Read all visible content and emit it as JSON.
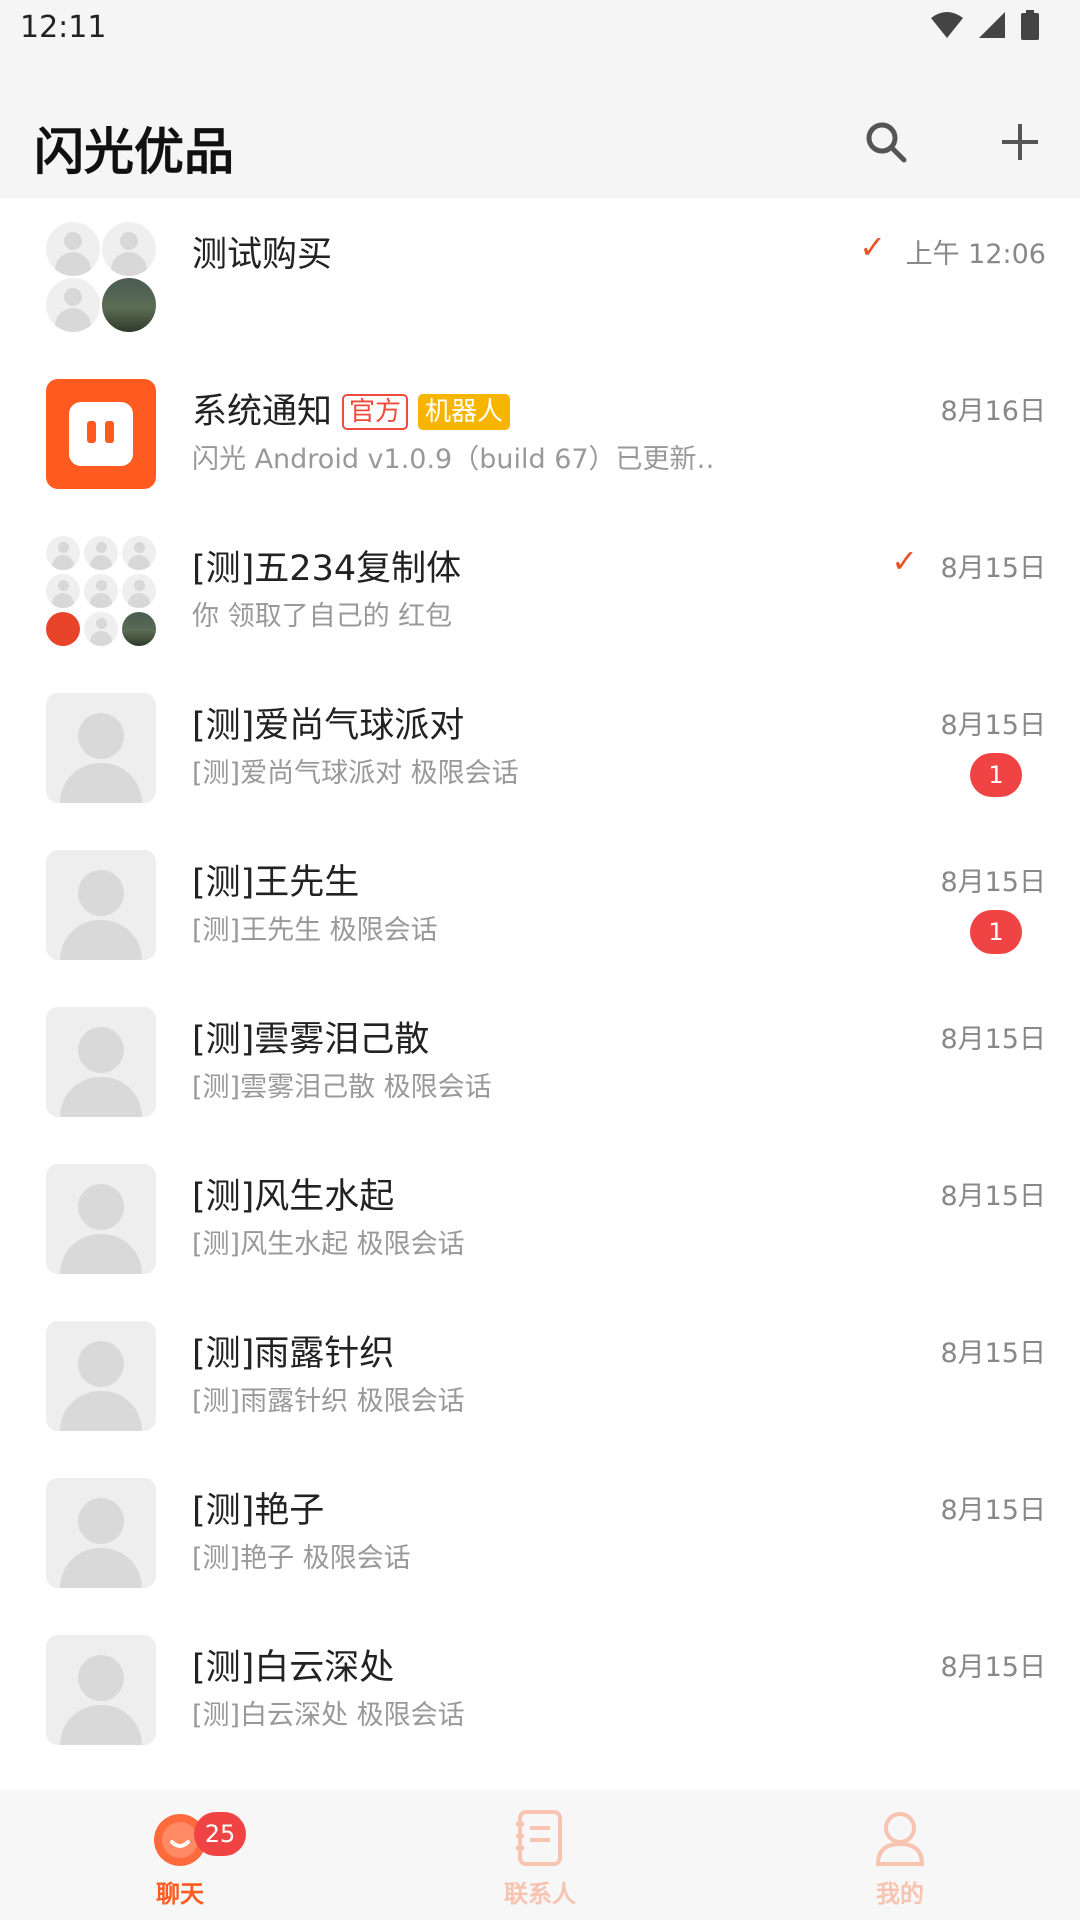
{
  "status_bar": {
    "time": "12:11"
  },
  "app_bar": {
    "title": "闪光优品",
    "search_icon": "search-icon",
    "add_icon": "plus-icon"
  },
  "colors": {
    "accent": "#ff5a1f",
    "badge": "#f04444",
    "check": "#e8552a",
    "official_tag": "#f04a3e",
    "bot_tag": "#f7b500"
  },
  "conversations": [
    {
      "name": "测试购买",
      "preview": "",
      "time": "上午 12:06",
      "sent": true,
      "avatar": "group-4"
    },
    {
      "name": "系统通知",
      "tags": [
        "官方",
        "机器人"
      ],
      "preview": "闪光 Android v1.0.9（build 67）已更新…",
      "time": "8月16日",
      "avatar": "system"
    },
    {
      "name": "[测]五234复制体",
      "preview": "你 领取了自己的 红包",
      "time": "8月15日",
      "sent": true,
      "avatar": "group-9"
    },
    {
      "name": "[测]爱尚气球派对",
      "preview": "[测]爱尚气球派对 极限会话",
      "time": "8月15日",
      "unread": "1",
      "avatar": "default"
    },
    {
      "name": "[测]王先生",
      "preview": "[测]王先生 极限会话",
      "time": "8月15日",
      "unread": "1",
      "avatar": "default"
    },
    {
      "name": "[测]雲雾泪己散",
      "preview": "[测]雲雾泪己散 极限会话",
      "time": "8月15日",
      "avatar": "default"
    },
    {
      "name": "[测]风生水起",
      "preview": "[测]风生水起 极限会话",
      "time": "8月15日",
      "avatar": "default"
    },
    {
      "name": "[测]雨露针织",
      "preview": "[测]雨露针织 极限会话",
      "time": "8月15日",
      "avatar": "default"
    },
    {
      "name": "[测]艳子",
      "preview": "[测]艳子 极限会话",
      "time": "8月15日",
      "avatar": "default"
    },
    {
      "name": "[测]白云深处",
      "preview": "[测]白云深处 极限会话",
      "time": "8月15日",
      "avatar": "default"
    }
  ],
  "tab_bar": {
    "tabs": [
      {
        "label": "聊天",
        "icon": "chat-bubble-icon",
        "badge": "25",
        "active": true
      },
      {
        "label": "联系人",
        "icon": "contacts-book-icon",
        "active": false
      },
      {
        "label": "我的",
        "icon": "person-icon",
        "active": false
      }
    ]
  }
}
